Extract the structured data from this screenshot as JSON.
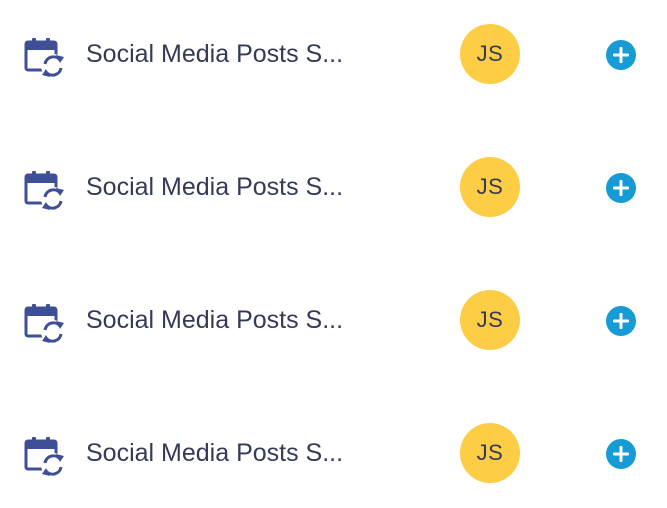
{
  "colors": {
    "icon": "#3f4f96",
    "title_text": "#343a58",
    "avatar_bg": "#fecd46",
    "add_button_bg": "#169bd4"
  },
  "tasks": [
    {
      "icon": "calendar-recurring-icon",
      "title": "Social Media Posts S...",
      "assignee_initials": "JS",
      "action_icon": "plus-circle-icon"
    },
    {
      "icon": "calendar-recurring-icon",
      "title": "Social Media Posts S...",
      "assignee_initials": "JS",
      "action_icon": "plus-circle-icon"
    },
    {
      "icon": "calendar-recurring-icon",
      "title": "Social Media Posts S...",
      "assignee_initials": "JS",
      "action_icon": "plus-circle-icon"
    },
    {
      "icon": "calendar-recurring-icon",
      "title": "Social Media Posts S...",
      "assignee_initials": "JS",
      "action_icon": "plus-circle-icon"
    }
  ]
}
